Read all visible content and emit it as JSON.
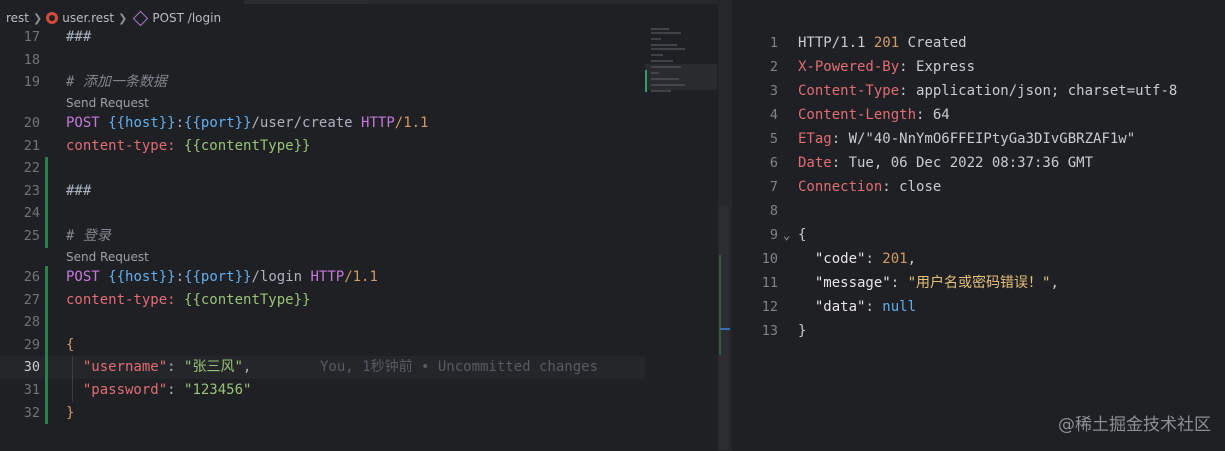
{
  "breadcrumb": {
    "folder": "rest",
    "file": "user.rest",
    "symbol": "POST /login"
  },
  "editor": {
    "lines": [
      {
        "n": "17",
        "text": "###"
      },
      {
        "n": "18",
        "text": ""
      },
      {
        "n": "19",
        "text": "# 添加一条数据"
      },
      {
        "lens": "Send Request"
      },
      {
        "n": "20",
        "method": "POST",
        "host": "{{host}}",
        "colon": ":",
        "port": "{{port}}",
        "path": "/user/create",
        "http": "HTTP",
        "ver": "/1.1"
      },
      {
        "n": "21",
        "hname": "content-type:",
        "hval": "{{contentType}}"
      },
      {
        "n": "22",
        "text": ""
      },
      {
        "n": "23",
        "text": "###"
      },
      {
        "n": "24",
        "text": ""
      },
      {
        "n": "25",
        "text": "# 登录"
      },
      {
        "lens": "Send Request"
      },
      {
        "n": "26",
        "method": "POST",
        "host": "{{host}}",
        "colon": ":",
        "port": "{{port}}",
        "path": "/login",
        "http": "HTTP",
        "ver": "/1.1"
      },
      {
        "n": "27",
        "hname": "content-type:",
        "hval": "{{contentType}}"
      },
      {
        "n": "28",
        "text": ""
      },
      {
        "n": "29",
        "brace": "{"
      },
      {
        "n": "30",
        "key": "\"username\"",
        "sep": ": ",
        "val": "\"张三风\"",
        "trail": ",",
        "blame": "You, 1秒钟前 • Uncommitted changes"
      },
      {
        "n": "31",
        "key": "\"password\"",
        "sep": ": ",
        "val": "\"123456\""
      },
      {
        "n": "32",
        "brace": "}"
      }
    ]
  },
  "response": {
    "lines": [
      {
        "n": "1",
        "a": "HTTP/1.1 ",
        "b": "201",
        "c": " Created"
      },
      {
        "n": "2",
        "hname": "X-Powered-By",
        "hval": ": Express"
      },
      {
        "n": "3",
        "hname": "Content-Type",
        "hval": ": application/json; charset=utf-8"
      },
      {
        "n": "4",
        "hname": "Content-Length",
        "hval": ": 64"
      },
      {
        "n": "5",
        "hname": "ETag",
        "hval": ": W/\"40-NnYmO6FFEIPtyGa3DIvGBRZAF1w\""
      },
      {
        "n": "6",
        "hname": "Date",
        "hval": ": Tue, 06 Dec 2022 08:37:36 GMT"
      },
      {
        "n": "7",
        "hname": "Connection",
        "hval": ": close"
      },
      {
        "n": "8",
        "plain": ""
      },
      {
        "n": "9",
        "plain": "{"
      },
      {
        "n": "10",
        "key": "\"code\"",
        "sep": ": ",
        "num": "201",
        "trail": ","
      },
      {
        "n": "11",
        "key": "\"message\"",
        "sep": ": ",
        "str": "\"用户名或密码错误！\"",
        "trail": ","
      },
      {
        "n": "12",
        "key": "\"data\"",
        "sep": ": ",
        "nul": "null"
      },
      {
        "n": "13",
        "plain": "}"
      }
    ]
  },
  "watermark": "@稀土掘金技术社区",
  "icons": {
    "breadcrumb_sep": "chevron-right-icon",
    "file": "rest-file-icon",
    "symbol": "symbol-cube-icon",
    "fold": "chevron-down-icon"
  },
  "colors": {
    "background": "#1f2023",
    "keyword": "#c678dd",
    "variable": "#61afef",
    "string": "#98c379",
    "number": "#d19a66",
    "json_key": "#e06c75",
    "gutter_added": "#2f7d4d"
  }
}
